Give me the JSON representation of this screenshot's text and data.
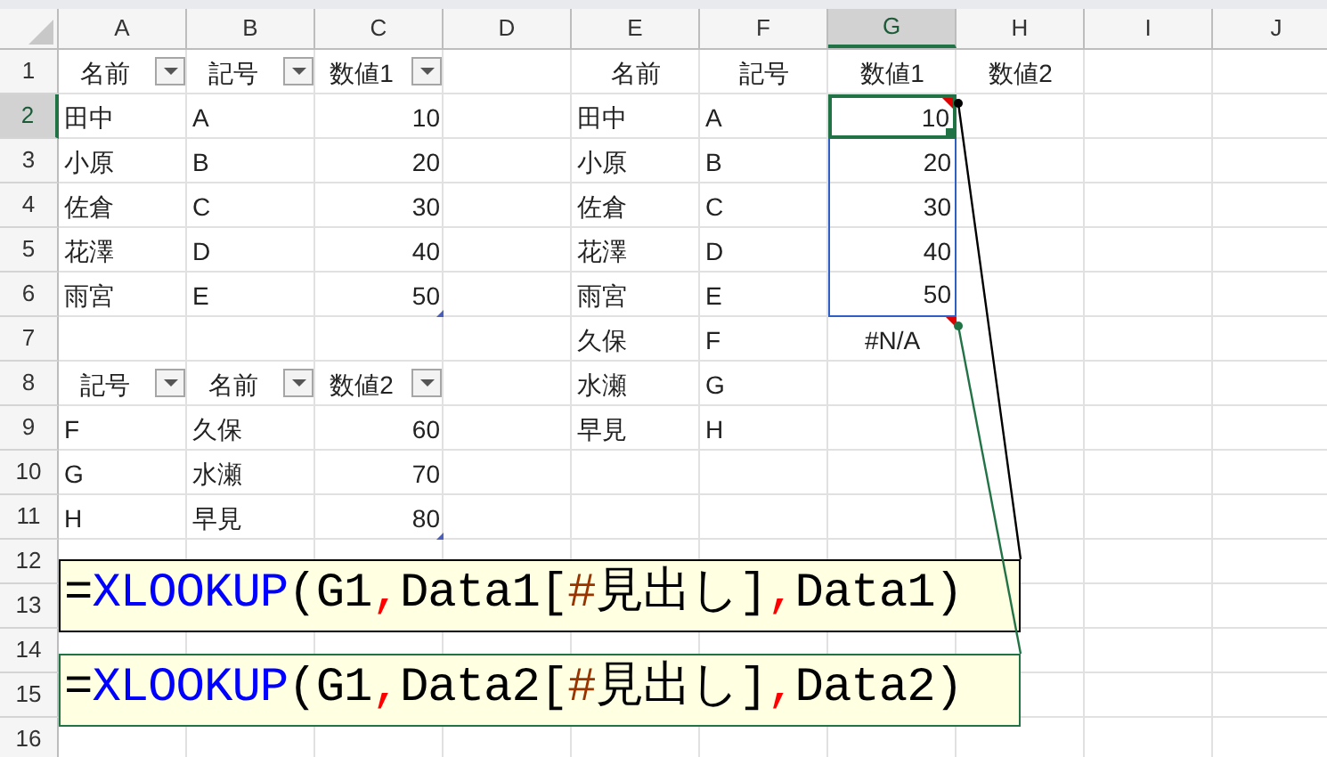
{
  "column_headers": [
    {
      "label": "A",
      "selected": false
    },
    {
      "label": "B",
      "selected": false
    },
    {
      "label": "C",
      "selected": false
    },
    {
      "label": "D",
      "selected": false
    },
    {
      "label": "E",
      "selected": false
    },
    {
      "label": "F",
      "selected": false
    },
    {
      "label": "G",
      "selected": true
    },
    {
      "label": "H",
      "selected": false
    },
    {
      "label": "I",
      "selected": false
    },
    {
      "label": "J",
      "selected": false
    }
  ],
  "rows": [
    {
      "number": "1",
      "selected": false,
      "cells": [
        {
          "text": "名前",
          "kind": "heading",
          "filter": true
        },
        {
          "text": "記号",
          "kind": "heading",
          "filter": true
        },
        {
          "text": "数値1",
          "kind": "heading",
          "filter": true
        },
        null,
        {
          "text": "名前",
          "kind": "heading"
        },
        {
          "text": "記号",
          "kind": "heading"
        },
        {
          "text": "数値1",
          "kind": "heading"
        },
        {
          "text": "数値2",
          "kind": "heading"
        },
        null,
        null
      ]
    },
    {
      "number": "2",
      "selected": true,
      "cells": [
        {
          "text": "田中",
          "kind": "text"
        },
        {
          "text": "A",
          "kind": "text"
        },
        {
          "text": "10",
          "kind": "number"
        },
        null,
        {
          "text": "田中",
          "kind": "text"
        },
        {
          "text": "A",
          "kind": "text"
        },
        {
          "text": "10",
          "kind": "number",
          "active": true,
          "in_range": true,
          "error_mark": true
        },
        null,
        null,
        null
      ]
    },
    {
      "number": "3",
      "selected": false,
      "cells": [
        {
          "text": "小原",
          "kind": "text"
        },
        {
          "text": "B",
          "kind": "text"
        },
        {
          "text": "20",
          "kind": "number"
        },
        null,
        {
          "text": "小原",
          "kind": "text"
        },
        {
          "text": "B",
          "kind": "text"
        },
        {
          "text": "20",
          "kind": "number",
          "in_range": true
        },
        null,
        null,
        null
      ]
    },
    {
      "number": "4",
      "selected": false,
      "cells": [
        {
          "text": "佐倉",
          "kind": "text"
        },
        {
          "text": "C",
          "kind": "text"
        },
        {
          "text": "30",
          "kind": "number"
        },
        null,
        {
          "text": "佐倉",
          "kind": "text"
        },
        {
          "text": "C",
          "kind": "text"
        },
        {
          "text": "30",
          "kind": "number",
          "in_range": true
        },
        null,
        null,
        null
      ]
    },
    {
      "number": "5",
      "selected": false,
      "cells": [
        {
          "text": "花澤",
          "kind": "text"
        },
        {
          "text": "D",
          "kind": "text"
        },
        {
          "text": "40",
          "kind": "number"
        },
        null,
        {
          "text": "花澤",
          "kind": "text"
        },
        {
          "text": "D",
          "kind": "text"
        },
        {
          "text": "40",
          "kind": "number",
          "in_range": true
        },
        null,
        null,
        null
      ]
    },
    {
      "number": "6",
      "selected": false,
      "cells": [
        {
          "text": "雨宮",
          "kind": "text"
        },
        {
          "text": "E",
          "kind": "text"
        },
        {
          "text": "50",
          "kind": "number",
          "table_corner": true
        },
        null,
        {
          "text": "雨宮",
          "kind": "text"
        },
        {
          "text": "E",
          "kind": "text"
        },
        {
          "text": "50",
          "kind": "number",
          "in_range": true
        },
        null,
        null,
        null
      ]
    },
    {
      "number": "7",
      "selected": false,
      "cells": [
        null,
        null,
        null,
        null,
        {
          "text": "久保",
          "kind": "text"
        },
        {
          "text": "F",
          "kind": "text"
        },
        {
          "text": "#N/A",
          "kind": "error",
          "error_mark": true
        },
        null,
        null,
        null
      ]
    },
    {
      "number": "8",
      "selected": false,
      "cells": [
        {
          "text": "記号",
          "kind": "heading",
          "filter": true
        },
        {
          "text": "名前",
          "kind": "heading",
          "filter": true
        },
        {
          "text": "数値2",
          "kind": "heading",
          "filter": true
        },
        null,
        {
          "text": "水瀬",
          "kind": "text"
        },
        {
          "text": "G",
          "kind": "text"
        },
        null,
        null,
        null,
        null
      ]
    },
    {
      "number": "9",
      "selected": false,
      "cells": [
        {
          "text": "F",
          "kind": "text"
        },
        {
          "text": "久保",
          "kind": "text"
        },
        {
          "text": "60",
          "kind": "number"
        },
        null,
        {
          "text": "早見",
          "kind": "text"
        },
        {
          "text": "H",
          "kind": "text"
        },
        null,
        null,
        null,
        null
      ]
    },
    {
      "number": "10",
      "selected": false,
      "cells": [
        {
          "text": "G",
          "kind": "text"
        },
        {
          "text": "水瀬",
          "kind": "text"
        },
        {
          "text": "70",
          "kind": "number"
        },
        null,
        null,
        null,
        null,
        null,
        null,
        null
      ]
    },
    {
      "number": "11",
      "selected": false,
      "cells": [
        {
          "text": "H",
          "kind": "text"
        },
        {
          "text": "早見",
          "kind": "text"
        },
        {
          "text": "80",
          "kind": "number",
          "table_corner": true
        },
        null,
        null,
        null,
        null,
        null,
        null,
        null
      ]
    },
    {
      "number": "12",
      "selected": false,
      "cells": [
        null,
        null,
        null,
        null,
        null,
        null,
        null,
        null,
        null,
        null
      ]
    },
    {
      "number": "13",
      "selected": false,
      "cells": [
        null,
        null,
        null,
        null,
        null,
        null,
        null,
        null,
        null,
        null
      ]
    },
    {
      "number": "14",
      "selected": false,
      "cells": [
        null,
        null,
        null,
        null,
        null,
        null,
        null,
        null,
        null,
        null
      ]
    },
    {
      "number": "15",
      "selected": false,
      "cells": [
        null,
        null,
        null,
        null,
        null,
        null,
        null,
        null,
        null,
        null
      ]
    },
    {
      "number": "16",
      "selected": false,
      "cells": [
        null,
        null,
        null,
        null,
        null,
        null,
        null,
        null,
        null,
        null
      ]
    }
  ],
  "trace_arrows": [
    {
      "color": "#000000"
    },
    {
      "color": "#217346"
    }
  ],
  "formula_notes": [
    {
      "color": "#000000",
      "segments": [
        {
          "text": "=",
          "kind": "plain"
        },
        {
          "text": "XLOOKUP",
          "kind": "function"
        },
        {
          "text": "(G1",
          "kind": "plain"
        },
        {
          "text": ",",
          "kind": "separator"
        },
        {
          "text": "Data1[",
          "kind": "plain"
        },
        {
          "text": "#",
          "kind": "special"
        },
        {
          "text": "見出し]",
          "kind": "plain"
        },
        {
          "text": ",",
          "kind": "separator"
        },
        {
          "text": "Data1)",
          "kind": "plain"
        }
      ]
    },
    {
      "color": "#217346",
      "segments": [
        {
          "text": "=",
          "kind": "plain"
        },
        {
          "text": "XLOOKUP",
          "kind": "function"
        },
        {
          "text": "(G1",
          "kind": "plain"
        },
        {
          "text": ",",
          "kind": "separator"
        },
        {
          "text": "Data2[",
          "kind": "plain"
        },
        {
          "text": "#",
          "kind": "special"
        },
        {
          "text": "見出し]",
          "kind": "plain"
        },
        {
          "text": ",",
          "kind": "separator"
        },
        {
          "text": "Data2)",
          "kind": "plain"
        }
      ]
    }
  ]
}
